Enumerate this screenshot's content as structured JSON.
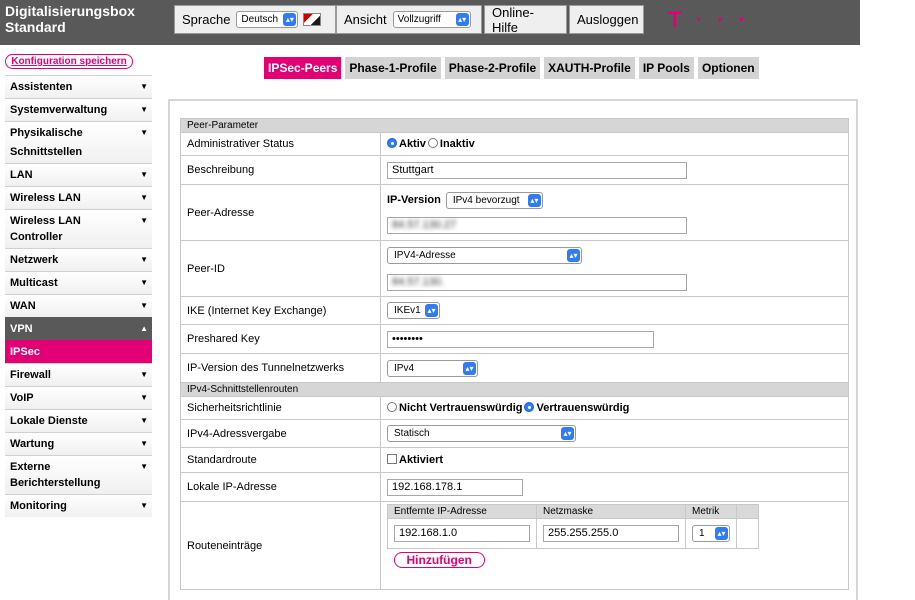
{
  "header": {
    "brand_line1": "Digitalisierungsbox",
    "brand_line2": "Standard",
    "language_label": "Sprache",
    "language_value": "Deutsch",
    "view_label": "Ansicht",
    "view_value": "Vollzugriff",
    "help_label": "Online-Hilfe",
    "logout_label": "Ausloggen",
    "logo": "T · · ·"
  },
  "sidebar": {
    "save_label": "Konfiguration speichern",
    "items": [
      {
        "label": "Assistenten"
      },
      {
        "label": "Systemverwaltung"
      },
      {
        "label": "Physikalische"
      },
      {
        "label": "Schnittstellen"
      },
      {
        "label": "LAN"
      },
      {
        "label": "Wireless LAN"
      },
      {
        "label": "Wireless LAN Controller"
      },
      {
        "label": "Netzwerk"
      },
      {
        "label": "Multicast"
      },
      {
        "label": "WAN"
      },
      {
        "label": "VPN"
      },
      {
        "label": "IPSec"
      },
      {
        "label": "Firewall"
      },
      {
        "label": "VoIP"
      },
      {
        "label": "Lokale Dienste"
      },
      {
        "label": "Wartung"
      },
      {
        "label": "Externe Berichterstellung"
      },
      {
        "label": "Monitoring"
      }
    ]
  },
  "tabs": [
    "IPSec-Peers",
    "Phase-1-Profile",
    "Phase-2-Profile",
    "XAUTH-Profile",
    "IP Pools",
    "Optionen"
  ],
  "form": {
    "section_peer": "Peer-Parameter",
    "admin_status_label": "Administrativer Status",
    "admin_status_on": "Aktiv",
    "admin_status_off": "Inaktiv",
    "description_label": "Beschreibung",
    "description_value": "Stuttgart",
    "peer_address_label": "Peer-Adresse",
    "ip_version_label": "IP-Version",
    "ip_version_value": "IPv4 bevorzugt",
    "peer_address_value": "84.57.130.27",
    "peer_id_label": "Peer-ID",
    "peer_id_type": "IPV4-Adresse",
    "peer_id_value": "84.57.130.",
    "ike_label": "IKE (Internet Key Exchange)",
    "ike_value": "IKEv1",
    "psk_label": "Preshared Key",
    "psk_value": "••••••••",
    "tunnel_ipver_label": "IP-Version des Tunnelnetzwerks",
    "tunnel_ipver_value": "IPv4",
    "section_routes": "IPv4-Schnittstellenrouten",
    "security_label": "Sicherheitsrichtlinie",
    "security_untrusted": "Nicht Vertrauenswürdig",
    "security_trusted": "Vertrauenswürdig",
    "addr_assign_label": "IPv4-Adressvergabe",
    "addr_assign_value": "Statisch",
    "default_route_label": "Standardroute",
    "default_route_check": "Aktiviert",
    "local_ip_label": "Lokale IP-Adresse",
    "local_ip_value": "192.168.178.1",
    "route_entries_label": "Routeneinträge",
    "routes_headers": [
      "Entfernte IP-Adresse",
      "Netzmaske",
      "Metrik"
    ],
    "route_ip": "192.168.1.0",
    "route_mask": "255.255.255.0",
    "route_metric": "1",
    "add_label": "Hinzufügen"
  },
  "colors": {
    "accent": "#e20074",
    "header_bg": "#595959",
    "select_blue": "#2f7cf6"
  }
}
